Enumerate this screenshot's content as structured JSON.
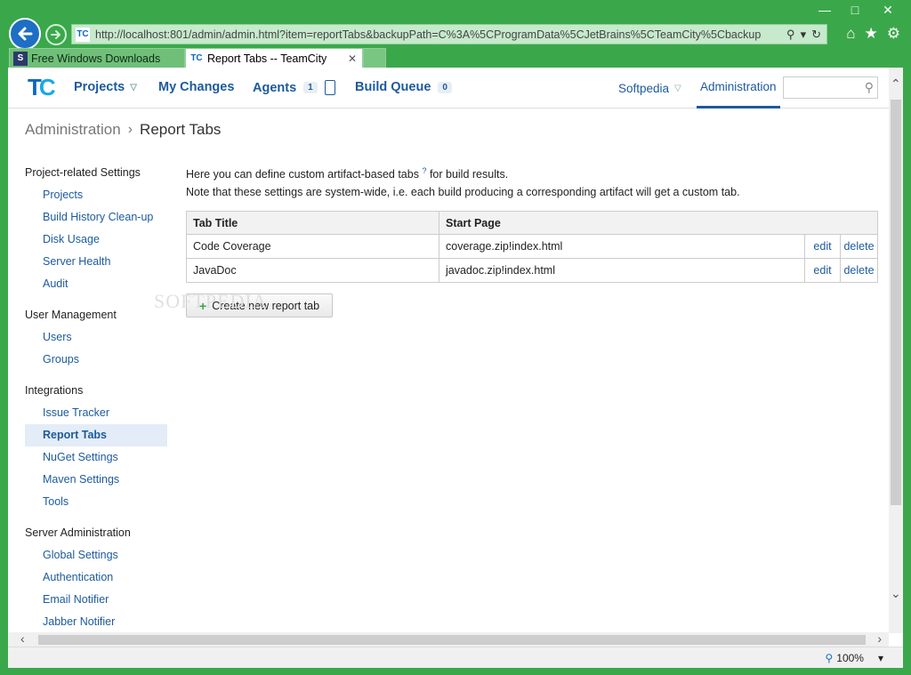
{
  "browser": {
    "url": "http://localhost:801/admin/admin.html?item=reportTabs&backupPath=C%3A%5CProgramData%5CJetBrains%5CTeamCity%5Cbackup",
    "tabs": [
      {
        "label": "Free Windows Downloads",
        "favicon": "S"
      },
      {
        "label": "Report Tabs -- TeamCity",
        "favicon": "TC"
      }
    ],
    "zoom": "100%"
  },
  "header": {
    "logo": "TC",
    "projects": "Projects",
    "my_changes": "My Changes",
    "agents": "Agents",
    "agents_count": "1",
    "build_queue": "Build Queue",
    "build_queue_count": "0",
    "user": "Softpedia",
    "administration": "Administration",
    "search_placeholder": ""
  },
  "breadcrumb": {
    "parent": "Administration",
    "current": "Report Tabs"
  },
  "sidebar": {
    "groups": [
      {
        "title": "Project-related Settings",
        "items": [
          "Projects",
          "Build History Clean-up",
          "Disk Usage",
          "Server Health",
          "Audit"
        ]
      },
      {
        "title": "User Management",
        "items": [
          "Users",
          "Groups"
        ]
      },
      {
        "title": "Integrations",
        "items": [
          "Issue Tracker",
          "Report Tabs",
          "NuGet Settings",
          "Maven Settings",
          "Tools"
        ]
      },
      {
        "title": "Server Administration",
        "items": [
          "Global Settings",
          "Authentication",
          "Email Notifier",
          "Jabber Notifier"
        ]
      }
    ],
    "selected": "Report Tabs"
  },
  "content": {
    "intro_line1a": "Here you can define custom artifact-based tabs",
    "intro_help": "?",
    "intro_line1b": "for build results.",
    "intro_line2": "Note that these settings are system-wide, i.e. each build producing a corresponding artifact will get a custom tab.",
    "table": {
      "headers": [
        "Tab Title",
        "Start Page"
      ],
      "rows": [
        {
          "title": "Code Coverage",
          "start_page": "coverage.zip!index.html",
          "edit": "edit",
          "delete": "delete"
        },
        {
          "title": "JavaDoc",
          "start_page": "javadoc.zip!index.html",
          "edit": "edit",
          "delete": "delete"
        }
      ]
    },
    "create_button": "Create new report tab"
  },
  "watermark": "SOFTPEDIA"
}
